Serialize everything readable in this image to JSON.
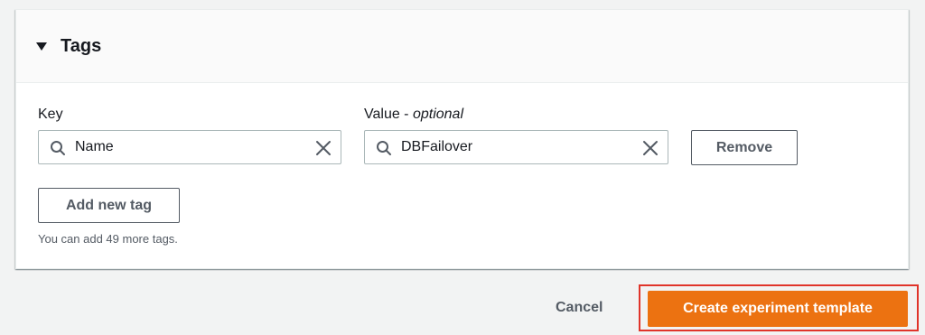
{
  "tags_panel": {
    "title": "Tags",
    "key_label": "Key",
    "value_label_prefix": "Value - ",
    "value_label_optional": "optional",
    "key_value": "Name",
    "value_value": "DBFailover",
    "remove_label": "Remove",
    "add_label": "Add new tag",
    "hint": "You can add 49 more tags."
  },
  "footer": {
    "cancel_label": "Cancel",
    "create_label": "Create experiment template"
  },
  "colors": {
    "primary": "#ec7211",
    "highlight": "#e0342a",
    "secondary_text": "#545b64"
  },
  "icons": [
    "caret-down-icon",
    "search-icon",
    "clear-icon"
  ]
}
